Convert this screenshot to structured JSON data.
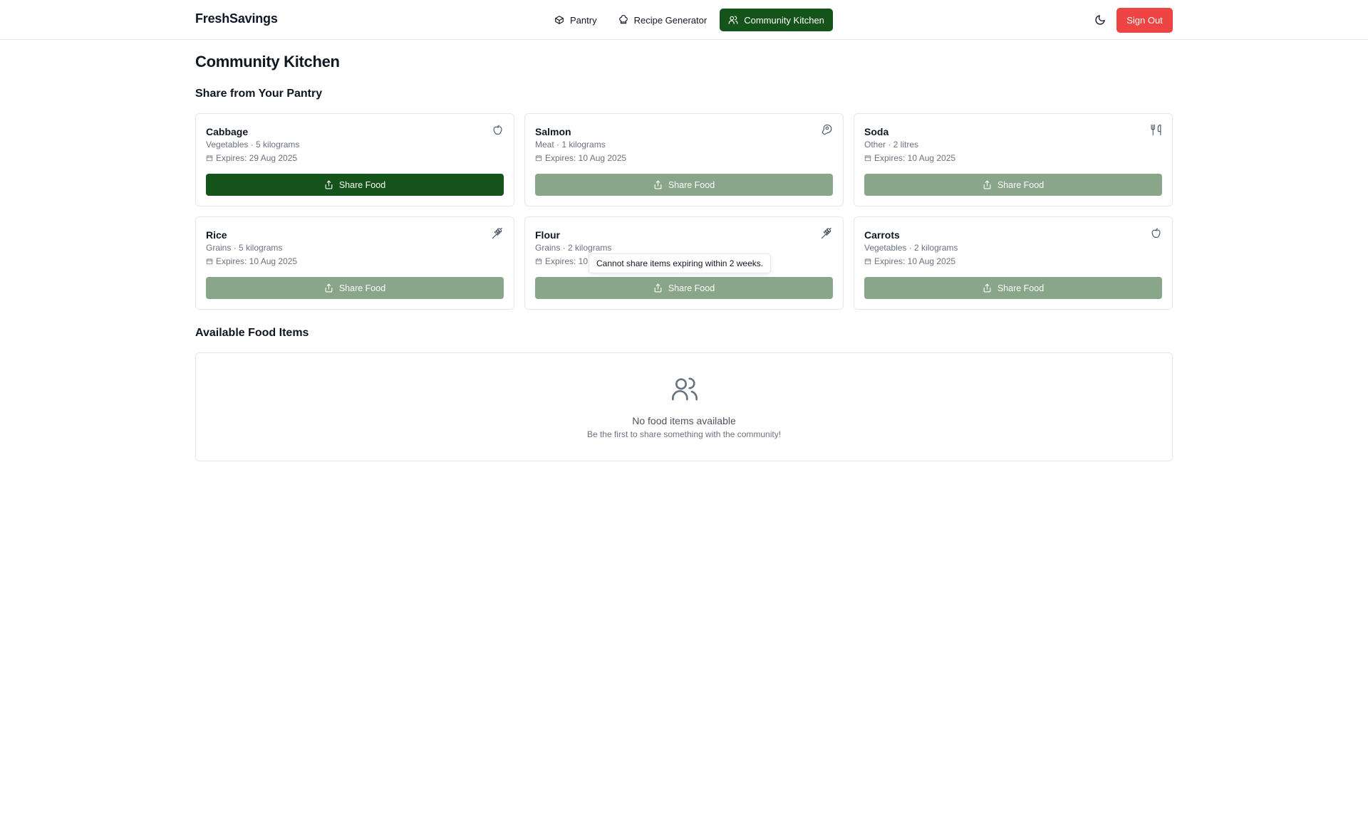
{
  "header": {
    "brand": "FreshSavings",
    "nav": [
      {
        "label": "Pantry",
        "icon": "box-icon",
        "active": false
      },
      {
        "label": "Recipe Generator",
        "icon": "chef-hat-icon",
        "active": false
      },
      {
        "label": "Community Kitchen",
        "icon": "users-icon",
        "active": true
      }
    ],
    "sign_out": "Sign Out",
    "theme_toggle_icon": "moon-icon"
  },
  "page": {
    "title": "Community Kitchen",
    "share_section_title": "Share from Your Pantry",
    "available_section_title": "Available Food Items"
  },
  "pantry_items": [
    {
      "name": "Cabbage",
      "meta": "Vegetables · 5 kilograms",
      "expires": "Expires: 29 Aug 2025",
      "icon": "apple-icon",
      "button": "Share Food",
      "enabled": true
    },
    {
      "name": "Salmon",
      "meta": "Meat · 1 kilograms",
      "expires": "Expires: 10 Aug 2025",
      "icon": "beef-icon",
      "button": "Share Food",
      "enabled": false
    },
    {
      "name": "Soda",
      "meta": "Other · 2 litres",
      "expires": "Expires: 10 Aug 2025",
      "icon": "utensils-icon",
      "button": "Share Food",
      "enabled": false
    },
    {
      "name": "Rice",
      "meta": "Grains · 5 kilograms",
      "expires": "Expires: 10 Aug 2025",
      "icon": "wheat-icon",
      "button": "Share Food",
      "enabled": false
    },
    {
      "name": "Flour",
      "meta": "Grains · 2 kilograms",
      "expires": "Expires: 10 Aug 2025",
      "icon": "wheat-icon",
      "button": "Share Food",
      "enabled": false
    },
    {
      "name": "Carrots",
      "meta": "Vegetables · 2 kilograms",
      "expires": "Expires: 10 Aug 2025",
      "icon": "apple-icon",
      "button": "Share Food",
      "enabled": false
    }
  ],
  "tooltip": "Cannot share items expiring within 2 weeks.",
  "empty_state": {
    "icon": "users-icon",
    "title": "No food items available",
    "subtitle": "Be the first to share something with the community!"
  },
  "colors": {
    "primary": "#14531a",
    "disabled_button": "#8aa68a",
    "danger": "#ef4444"
  }
}
